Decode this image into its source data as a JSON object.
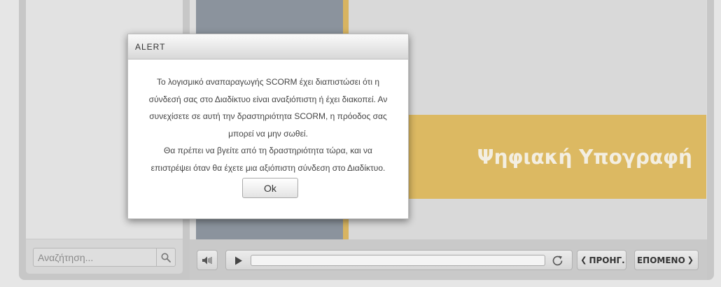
{
  "sidebar": {
    "search": {
      "placeholder": "Αναζήτηση...",
      "icon": "search-icon"
    }
  },
  "slide": {
    "title": "Ψηφιακή Υπογραφή",
    "colors": {
      "panel": "#8b939d",
      "accent": "#dcb962"
    }
  },
  "player": {
    "volume_icon": "speaker-icon",
    "play_icon": "play-icon",
    "replay_icon": "replay-icon",
    "progress": 0,
    "prev_label": "ΠΡΟΗΓ.",
    "next_label": "ΕΠΟΜΕΝΟ"
  },
  "alert": {
    "title": "ALERT",
    "lines": [
      "Το λογισμικό αναπαραγωγής SCORM έχει διαπιστώσει ότι η",
      "σύνδεσή σας στο Διαδίκτυο είναι αναξιόπιστη ή έχει διακοπεί. Αν",
      "συνεχίσετε σε αυτή την δραστηριότητα SCORM, η πρόοδος σας",
      "μπορεί να μην σωθεί.",
      "Θα πρέπει να βγείτε από τη δραστηριότητα τώρα, και να",
      "επιστρέψει όταν θα έχετε μια αξιόπιστη σύνδεση στο Διαδίκτυο."
    ],
    "ok_label": "Ok"
  }
}
